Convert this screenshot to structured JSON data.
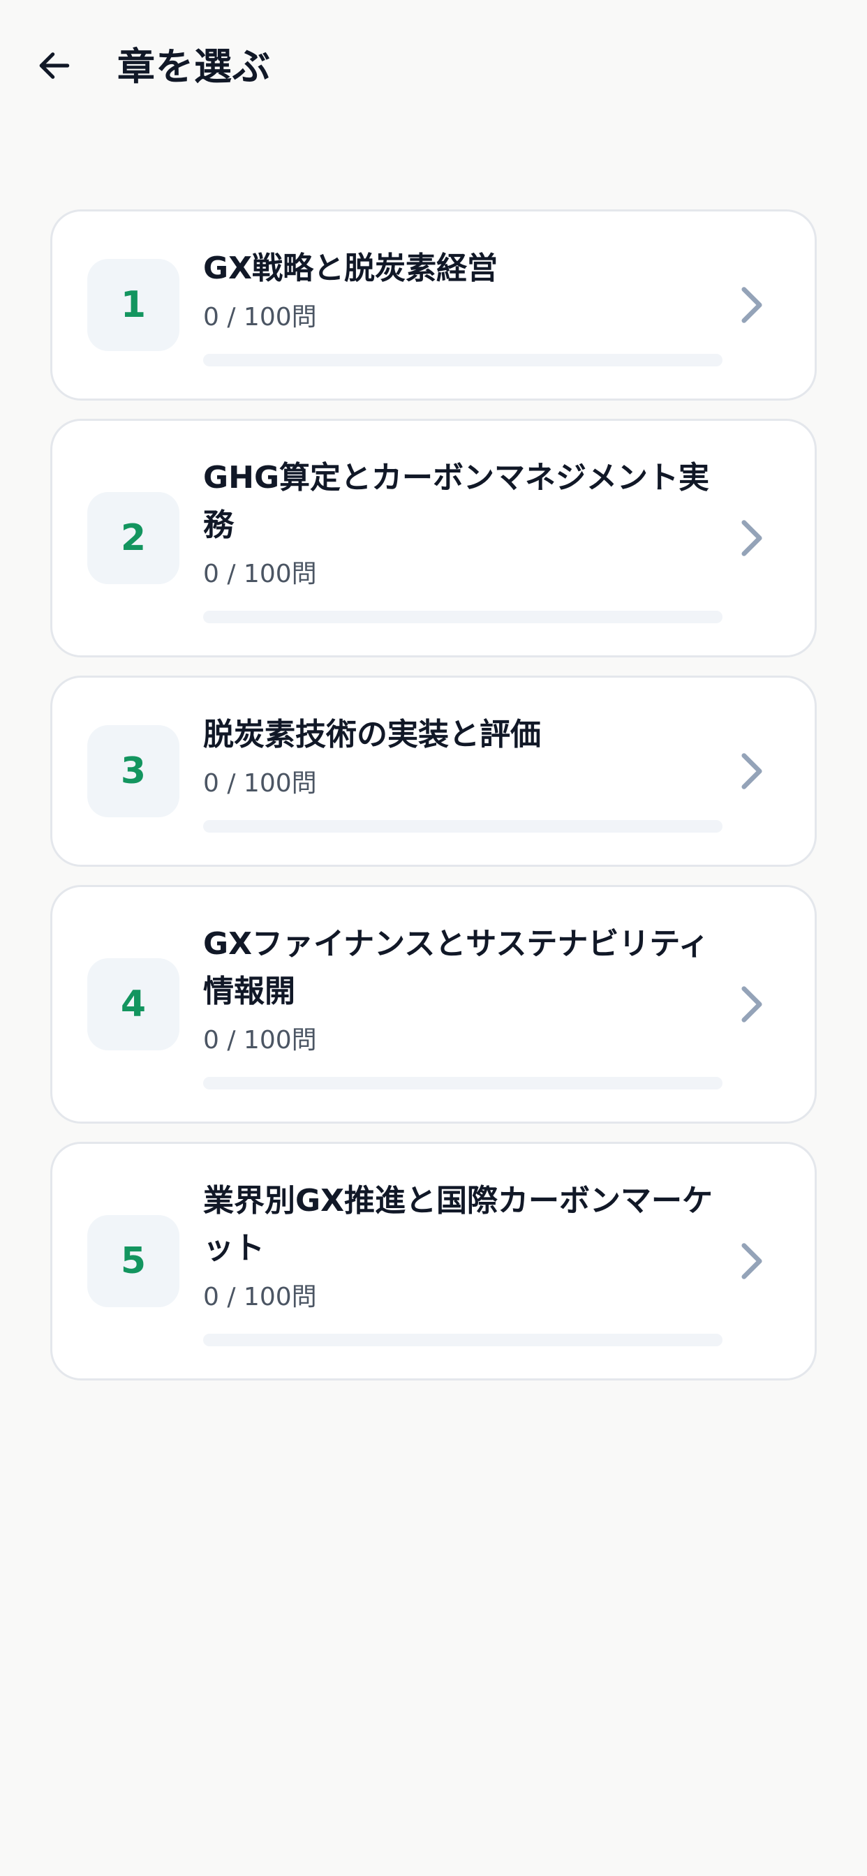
{
  "header": {
    "title": "章を選ぶ",
    "back_icon": "arrow-left-icon"
  },
  "colors": {
    "background": "#f9f9f8",
    "accent_green": "#13955f",
    "badge_bg": "#f1f5f9",
    "chevron": "#94a3b8",
    "track": "#f1f4f8"
  },
  "chapters": [
    {
      "number": "1",
      "title": "GX戦略と脱炭素経営",
      "progress_text": "0 / 100問",
      "progress": 0
    },
    {
      "number": "2",
      "title": "GHG算定とカーボンマネジメント実務",
      "progress_text": "0 / 100問",
      "progress": 0
    },
    {
      "number": "3",
      "title": "脱炭素技術の実装と評価",
      "progress_text": "0 / 100問",
      "progress": 0
    },
    {
      "number": "4",
      "title": "GXファイナンスとサステナビリティ情報開",
      "progress_text": "0 / 100問",
      "progress": 0
    },
    {
      "number": "5",
      "title": "業界別GX推進と国際カーボンマーケット",
      "progress_text": "0 / 100問",
      "progress": 0
    }
  ]
}
